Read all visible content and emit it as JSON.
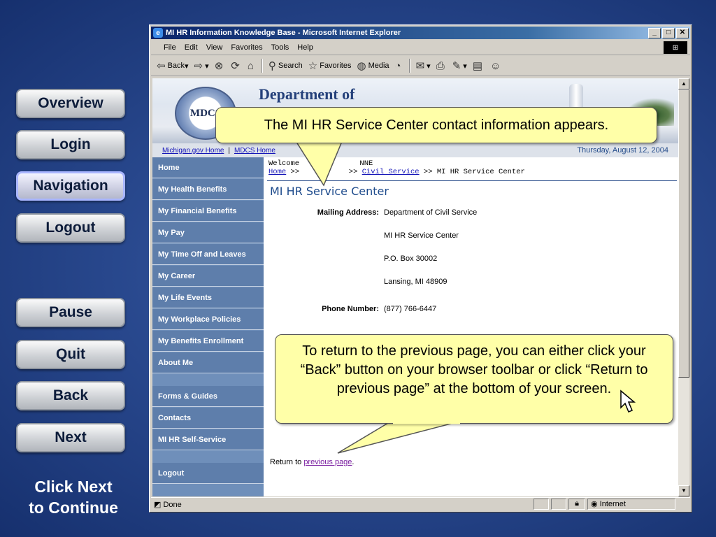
{
  "tutorial_nav": {
    "buttons": [
      "Overview",
      "Login",
      "Navigation",
      "Logout"
    ],
    "controls": [
      "Pause",
      "Quit",
      "Back",
      "Next"
    ],
    "active": "Navigation",
    "hint": "Click Next to Continue"
  },
  "browser": {
    "title": "MI HR Information Knowledge Base - Microsoft Internet Explorer",
    "menu": [
      "File",
      "Edit",
      "View",
      "Favorites",
      "Tools",
      "Help"
    ],
    "toolbar": {
      "back": "Back",
      "search": "Search",
      "favorites": "Favorites",
      "media": "Media"
    },
    "status": {
      "text": "Done",
      "zone": "Internet"
    }
  },
  "page": {
    "banner": {
      "seal_text": "MDCS",
      "dept_title": "Department of"
    },
    "crumbline": {
      "links": [
        "Michigan.gov Home",
        "MDCS Home"
      ],
      "separator": "|",
      "date": "Thursday, August 12, 2004"
    },
    "welcome": "Welcome",
    "welcome_suffix": "NNE",
    "breadcrumb": {
      "home": "Home",
      "sep": ">>",
      "civil": "Civil Service",
      "current": ">> MI HR Service Center"
    },
    "nav": [
      "Home",
      "My Health Benefits",
      "My Financial Benefits",
      "My Pay",
      "My Time Off and Leaves",
      "My Career",
      "My Life Events",
      "My Workplace Policies",
      "My Benefits Enrollment",
      "About Me",
      "Forms & Guides",
      "Contacts",
      "MI HR Self-Service",
      "Logout"
    ],
    "title": "MI HR Service Center",
    "mailing_label": "Mailing Address:",
    "address": [
      "Department of Civil Service",
      "MI HR Service Center",
      "P.O. Box 30002",
      "Lansing, MI  48909"
    ],
    "phone_label": "Phone Number:",
    "phone": "(877) 766-6447",
    "return_prefix": "Return to",
    "return_link": "previous page",
    "return_suffix": "."
  },
  "callouts": {
    "top": "The MI HR Service Center contact information appears.",
    "bottom": "To return to the previous page, you can either click your “Back” button on your browser toolbar or click “Return to previous page” at the bottom of your screen."
  }
}
